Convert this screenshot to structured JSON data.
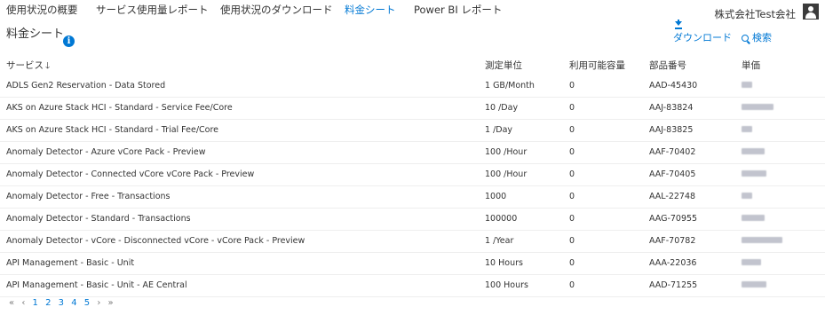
{
  "nav": {
    "tabs": [
      {
        "label": "使用状況の概要"
      },
      {
        "label": "サービス使用量レポート"
      },
      {
        "label": "使用状況のダウンロード"
      },
      {
        "label": "料金シート"
      },
      {
        "label": "Power BI レポート"
      }
    ],
    "active_tab": "料金シート",
    "company": "株式会社Test会社"
  },
  "page": {
    "title": "料金シート",
    "info_icon": "info-icon",
    "download_label": "ダウンロード",
    "search_label": "検索"
  },
  "table": {
    "headers": {
      "service": "サービス",
      "unit": "測定単位",
      "included": "利用可能容量",
      "part": "部品番号",
      "price": "単価"
    },
    "sort_arrow": "🡓",
    "rows": [
      {
        "service": "ADLS Gen2 Reservation - Data Stored",
        "unit": "1 GB/Month",
        "included": "0",
        "part": "AAD-45430"
      },
      {
        "service": "AKS on Azure Stack HCI - Standard - Service Fee/Core",
        "unit": "10 /Day",
        "included": "0",
        "part": "AAJ-83824"
      },
      {
        "service": "AKS on Azure Stack HCI - Standard - Trial Fee/Core",
        "unit": "1 /Day",
        "included": "0",
        "part": "AAJ-83825"
      },
      {
        "service": "Anomaly Detector - Azure vCore Pack - Preview",
        "unit": "100 /Hour",
        "included": "0",
        "part": "AAF-70402"
      },
      {
        "service": "Anomaly Detector - Connected vCore vCore Pack - Preview",
        "unit": "100 /Hour",
        "included": "0",
        "part": "AAF-70405"
      },
      {
        "service": "Anomaly Detector - Free - Transactions",
        "unit": "1000",
        "included": "0",
        "part": "AAL-22748"
      },
      {
        "service": "Anomaly Detector - Standard - Transactions",
        "unit": "100000",
        "included": "0",
        "part": "AAG-70955"
      },
      {
        "service": "Anomaly Detector - vCore - Disconnected vCore - vCore Pack - Preview",
        "unit": "1 /Year",
        "included": "0",
        "part": "AAF-70782"
      },
      {
        "service": "API Management - Basic - Unit",
        "unit": "10 Hours",
        "included": "0",
        "part": "AAA-22036"
      },
      {
        "service": "API Management - Basic - Unit - AE Central",
        "unit": "100 Hours",
        "included": "0",
        "part": "AAD-71255"
      }
    ]
  },
  "pagination": {
    "first": "«",
    "prev": "‹",
    "pages": [
      "1",
      "2",
      "3",
      "4",
      "5"
    ],
    "next": "›",
    "last": "»"
  }
}
